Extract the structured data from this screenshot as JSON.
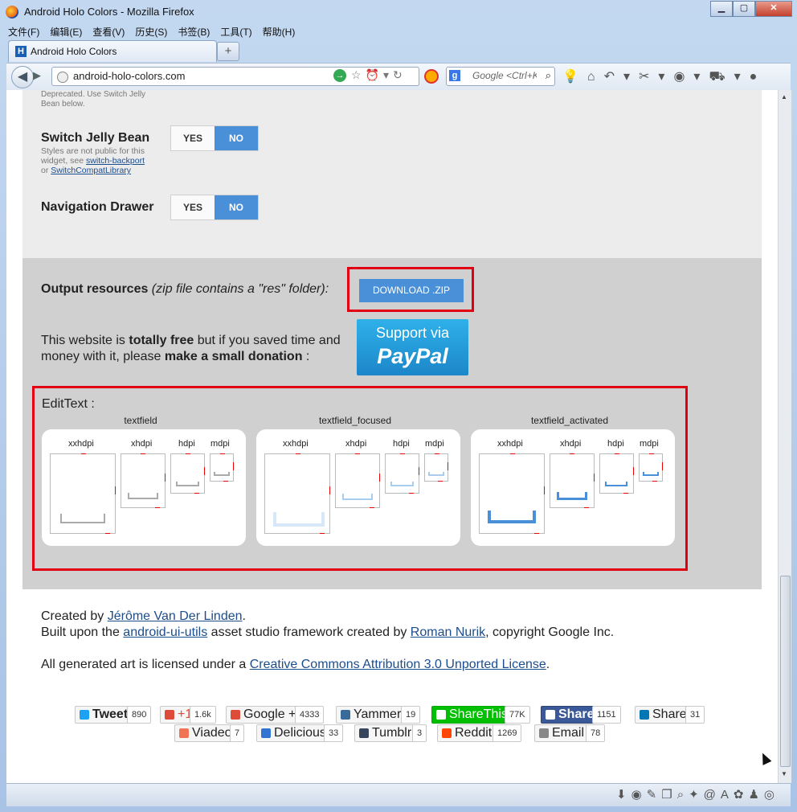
{
  "window": {
    "title": "Android Holo Colors - Mozilla Firefox",
    "min": "▁",
    "max": "▢",
    "close": "✕"
  },
  "menu": [
    "文件(F)",
    "编辑(E)",
    "查看(V)",
    "历史(S)",
    "书签(B)",
    "工具(T)",
    "帮助(H)"
  ],
  "tab": {
    "icon": "H",
    "label": "Android Holo Colors",
    "new": "+"
  },
  "nav": {
    "url": "android-holo-colors.com",
    "search_placeholder": "Google <Ctrl+K>",
    "search_engine": "g"
  },
  "page": {
    "deprecated": "Deprecated. Use Switch Jelly Bean below.",
    "switch": {
      "label": "Switch Jelly Bean",
      "note1": "Styles are not public for this",
      "note2": "widget, see ",
      "link1": "switch-backport",
      "note3": "or ",
      "link2": "SwitchCompatLibrary",
      "yes": "YES",
      "no": "NO"
    },
    "drawer": {
      "label": "Navigation Drawer",
      "yes": "YES",
      "no": "NO"
    },
    "output": {
      "label_bold": "Output resources",
      "label_rest": " (zip file contains a \"res\" folder):",
      "button": "DOWNLOAD .ZIP"
    },
    "donate": {
      "t1": "This website is ",
      "t2": "totally free",
      "t3": " but if you saved time and money with it, please ",
      "t4": "make a small donation",
      "t5": " :",
      "pp_line1": "Support via",
      "pp_line2": "PayPal"
    },
    "edittext": {
      "label": "EditText :",
      "cards": [
        {
          "title": "textfield"
        },
        {
          "title": "textfield_focused"
        },
        {
          "title": "textfield_activated"
        }
      ],
      "dpis": [
        "xxhdpi",
        "xhdpi",
        "hdpi",
        "mdpi"
      ]
    },
    "footer": {
      "created": "Created by ",
      "author": "Jérôme Van Der Linden",
      "dot": ".",
      "built": "Built upon the ",
      "lib": "android-ui-utils",
      "built2": " asset studio framework created by ",
      "roman": "Roman Nurik",
      "built3": ", copyright Google Inc.",
      "lic": "All generated art is licensed under a ",
      "lic_link": "Creative Commons Attribution 3.0 Unported License",
      "dot2": "."
    },
    "share": [
      {
        "label": "Tweet",
        "count": "890",
        "color": "#1da1f2"
      },
      {
        "label": "+1",
        "count": "1.6k",
        "color": "#dd4b39"
      },
      {
        "label": "Google +",
        "count": "4333",
        "color": "#dd4b39"
      },
      {
        "label": "Yammer",
        "count": "19",
        "color": "#396b9a"
      },
      {
        "label": "ShareThis",
        "count": "77K",
        "color": "#00bf00"
      },
      {
        "label": "Share",
        "count": "1151",
        "color": "#3b5998"
      },
      {
        "label": "Share",
        "count": "31",
        "color": "#0077b5"
      },
      {
        "label": "Viadeo",
        "count": "7",
        "color": "#f07355"
      },
      {
        "label": "Delicious",
        "count": "33",
        "color": "#3274d1"
      },
      {
        "label": "Tumblr",
        "count": "3",
        "color": "#35465c"
      },
      {
        "label": "Reddit",
        "count": "1269",
        "color": "#ff4500"
      },
      {
        "label": "Email",
        "count": "78",
        "color": "#888888"
      }
    ]
  }
}
